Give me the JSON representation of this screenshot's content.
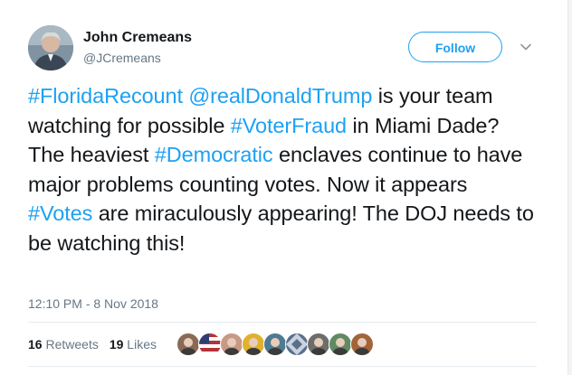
{
  "user": {
    "display_name": "John Cremeans",
    "handle": "@JCremeans"
  },
  "follow_label": "Follow",
  "tweet_tokens": [
    {
      "text": "#FloridaRecount",
      "link": true
    },
    {
      "text": " ",
      "link": false
    },
    {
      "text": "@realDonaldTrump",
      "link": true
    },
    {
      "text": " is your team watching for possible ",
      "link": false
    },
    {
      "text": "#VoterFraud",
      "link": true
    },
    {
      "text": " in Miami Dade? The heaviest ",
      "link": false
    },
    {
      "text": "#Democratic",
      "link": true
    },
    {
      "text": " enclaves continue to have major problems counting votes. Now it appears ",
      "link": false
    },
    {
      "text": "#Votes",
      "link": true
    },
    {
      "text": " are miraculously appearing! The DOJ needs to be watching this!",
      "link": false
    }
  ],
  "timestamp": "12:10 PM - 8 Nov 2018",
  "stats": {
    "retweets": {
      "count": "16",
      "label": "Retweets"
    },
    "likes": {
      "count": "19",
      "label": "Likes"
    }
  },
  "colors": {
    "accent": "#1da1f2",
    "text": "#14171a",
    "muted": "#657786",
    "divider": "#e6ecf0"
  },
  "liker_avatars": [
    {
      "icon": "user-avatar-icon",
      "color": "#8b6a55"
    },
    {
      "icon": "flag-avatar-icon",
      "color": "#b5323a"
    },
    {
      "icon": "user-avatar-icon",
      "color": "#c79a86"
    },
    {
      "icon": "user-avatar-icon",
      "color": "#e0b030"
    },
    {
      "icon": "user-avatar-icon",
      "color": "#4f7a93"
    },
    {
      "icon": "pattern-avatar-icon",
      "color": "#5a6f8c"
    },
    {
      "icon": "user-avatar-icon",
      "color": "#6d6d6d"
    },
    {
      "icon": "user-avatar-icon",
      "color": "#5f8a63"
    },
    {
      "icon": "user-avatar-icon",
      "color": "#a3643a"
    }
  ]
}
